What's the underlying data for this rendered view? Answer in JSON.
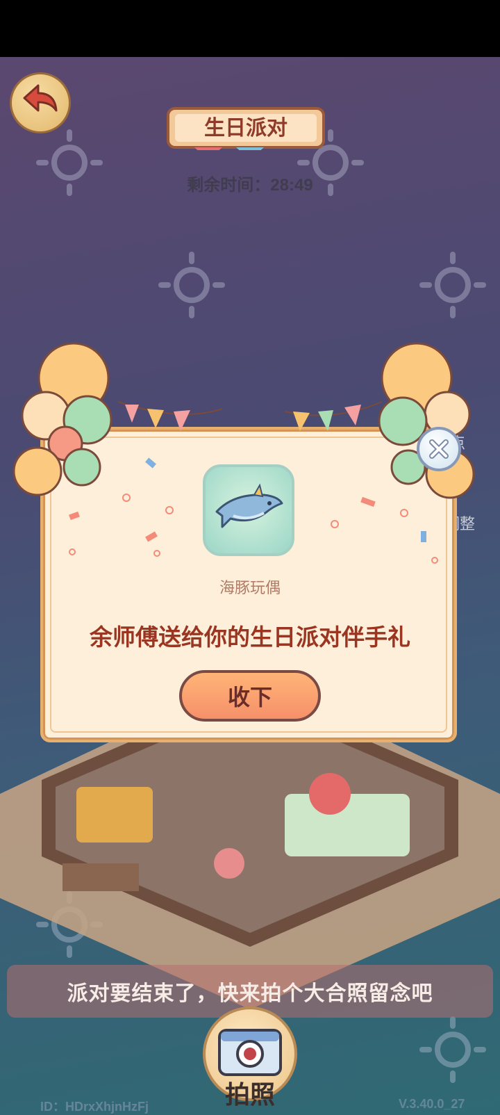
{
  "header": {
    "title": "生日派对",
    "timer_label": "剩余时间：",
    "timer_value": "28:49"
  },
  "side_labels": {
    "right_partial": "点",
    "adjust": "调整"
  },
  "gift_modal": {
    "item_name": "海豚玩偶",
    "message": "余师傅送给你的生日派对伴手礼",
    "accept_button": "收下",
    "item_icon": "dolphin-plush-icon"
  },
  "footer": {
    "prompt": "派对要结束了，快来拍个大合照留念吧",
    "camera_button": "拍照",
    "user_id": "ID：HDrxXhjnHzFj",
    "version": "V.3.40.0_27"
  },
  "colors": {
    "title_text": "#8e3b2a",
    "message_text": "#9a3522",
    "modal_bg": "#fdefd9",
    "button_fill": "#f6906a"
  }
}
